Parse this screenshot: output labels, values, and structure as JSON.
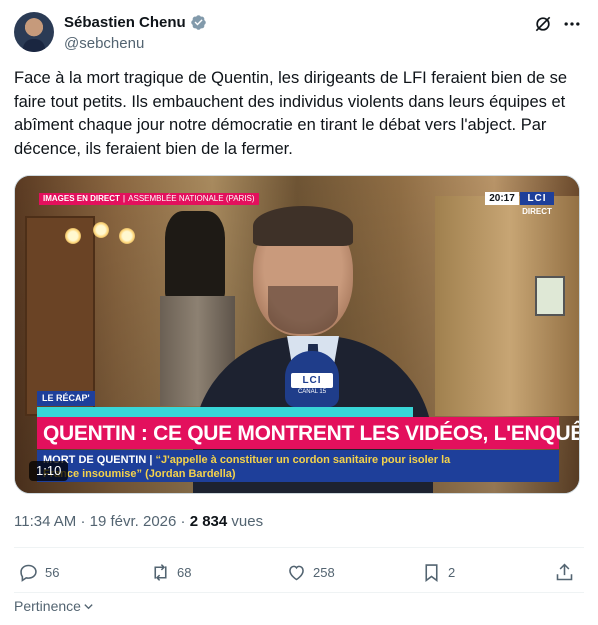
{
  "author": {
    "display_name": "Sébastien Chenu",
    "handle": "@sebchenu"
  },
  "tweet": {
    "text": "Face à la mort tragique de Quentin, les dirigeants de LFI feraient bien de se faire tout petits. Ils embauchent des individus violents dans leurs équipes et abîment chaque jour notre démocratie en tirant le débat vers l'abject. Par décence, ils feraient bien de la fermer."
  },
  "media": {
    "live_tag_main": "IMAGES EN DIRECT",
    "live_tag_location": "ASSEMBLÉE NATIONALE (PARIS)",
    "clock": "20:17",
    "channel": "LCI",
    "direct_label": "DIRECT",
    "mic_logo": "LCI",
    "mic_sub": "CANAL 15",
    "recap_tag": "LE RÉCAP'",
    "headline": "QUENTIN : CE QUE MONTRENT LES VIDÉOS, L'ENQUÊTE LCI",
    "sub_label": "MORT DE QUENTIN |",
    "sub_quote": "“J'appelle à constituer un cordon sanitaire pour isoler la France insoumise” (Jordan Bardella)",
    "duration": "1:10"
  },
  "meta": {
    "time": "11:34 AM",
    "separator": "·",
    "date": "19 févr. 2026",
    "views_count": "2 834",
    "views_label": "vues"
  },
  "actions": {
    "replies": "56",
    "reposts": "68",
    "likes": "258",
    "bookmarks": "2"
  },
  "relevance": {
    "label": "Pertinence"
  },
  "colors": {
    "accent_lci_pink": "#e3105d",
    "accent_lci_blue": "#1e3f9a",
    "verified_blue": "#829aab",
    "muted_text": "#536471"
  },
  "icons": [
    "verified-badge-icon",
    "grok-icon",
    "more-icon",
    "reply-icon",
    "repost-icon",
    "like-icon",
    "bookmark-icon",
    "share-icon",
    "chevron-down-icon"
  ]
}
